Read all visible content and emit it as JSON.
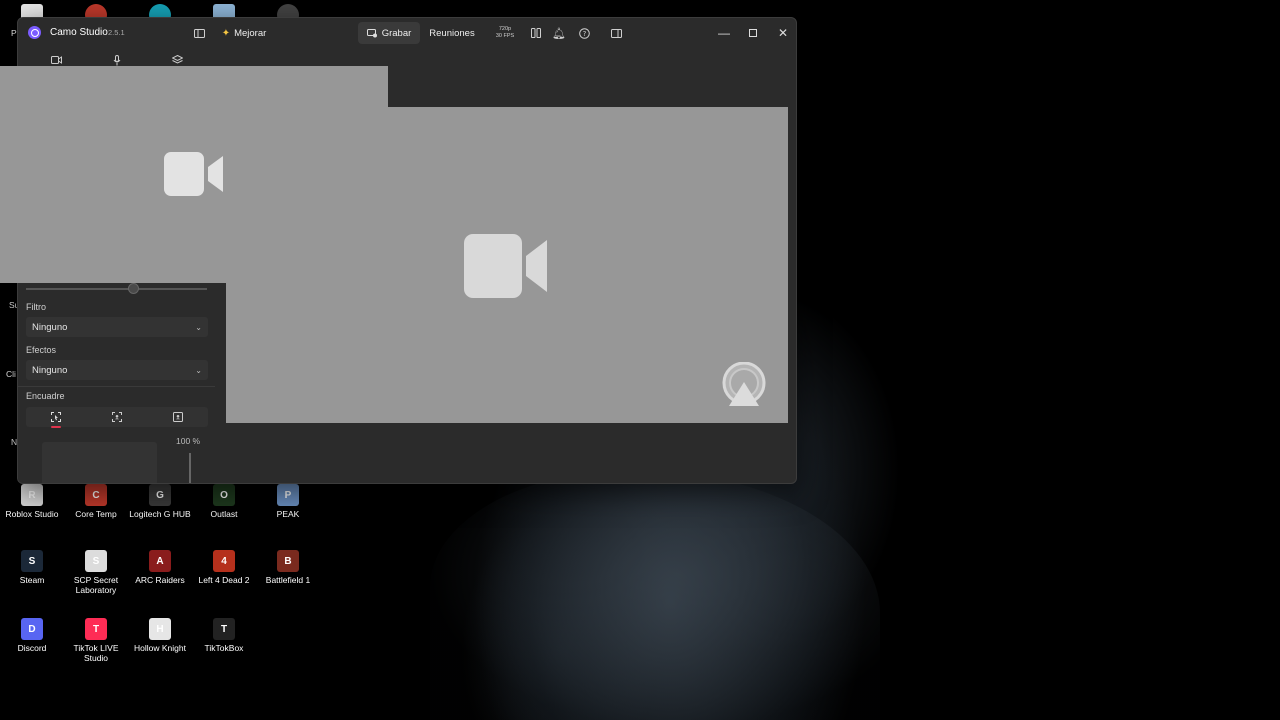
{
  "window": {
    "app_title": "Camo Studio",
    "version": "2.5.1",
    "enhance_label": "Mejorar",
    "record_label": "Grabar",
    "meetings_label": "Reuniones",
    "resolution": "720p",
    "fps": "30 FPS"
  },
  "sidebar": {
    "filter_label": "Filtro",
    "filter_value": "Ninguno",
    "effects_label": "Efectos",
    "effects_value": "Ninguno",
    "framing_label": "Encuadre",
    "zoom_percent": "100 %"
  },
  "desktop": {
    "partial_labels": [
      "Pa",
      "Su",
      "Cli",
      "N"
    ],
    "icons": [
      {
        "label": "Roblox Studio",
        "color": "#d8d8d8",
        "glyph": "R"
      },
      {
        "label": "Core Temp",
        "color": "#c0392b",
        "glyph": "C"
      },
      {
        "label": "Logitech G HUB",
        "color": "#3b3b3b",
        "glyph": "G"
      },
      {
        "label": "Outlast",
        "color": "#1e3a1e",
        "glyph": "O"
      },
      {
        "label": "PEAK",
        "color": "#6a8fc0",
        "glyph": "P"
      },
      {
        "label": "Steam",
        "color": "#1b2838",
        "glyph": "S"
      },
      {
        "label": "SCP Secret Laboratory",
        "color": "#dcdcdc",
        "glyph": "S"
      },
      {
        "label": "ARC Raiders",
        "color": "#8a1c1c",
        "glyph": "A"
      },
      {
        "label": "Left 4 Dead 2",
        "color": "#b5301c",
        "glyph": "4"
      },
      {
        "label": "Battlefield 1",
        "color": "#7a2a1e",
        "glyph": "B"
      },
      {
        "label": "Discord",
        "color": "#5865f2",
        "glyph": "D"
      },
      {
        "label": "TikTok LIVE Studio",
        "color": "#fe2c55",
        "glyph": "T"
      },
      {
        "label": "Hollow Knight",
        "color": "#e6e6e6",
        "glyph": "H"
      },
      {
        "label": "TikTokBox",
        "color": "#222",
        "glyph": "T"
      }
    ]
  }
}
